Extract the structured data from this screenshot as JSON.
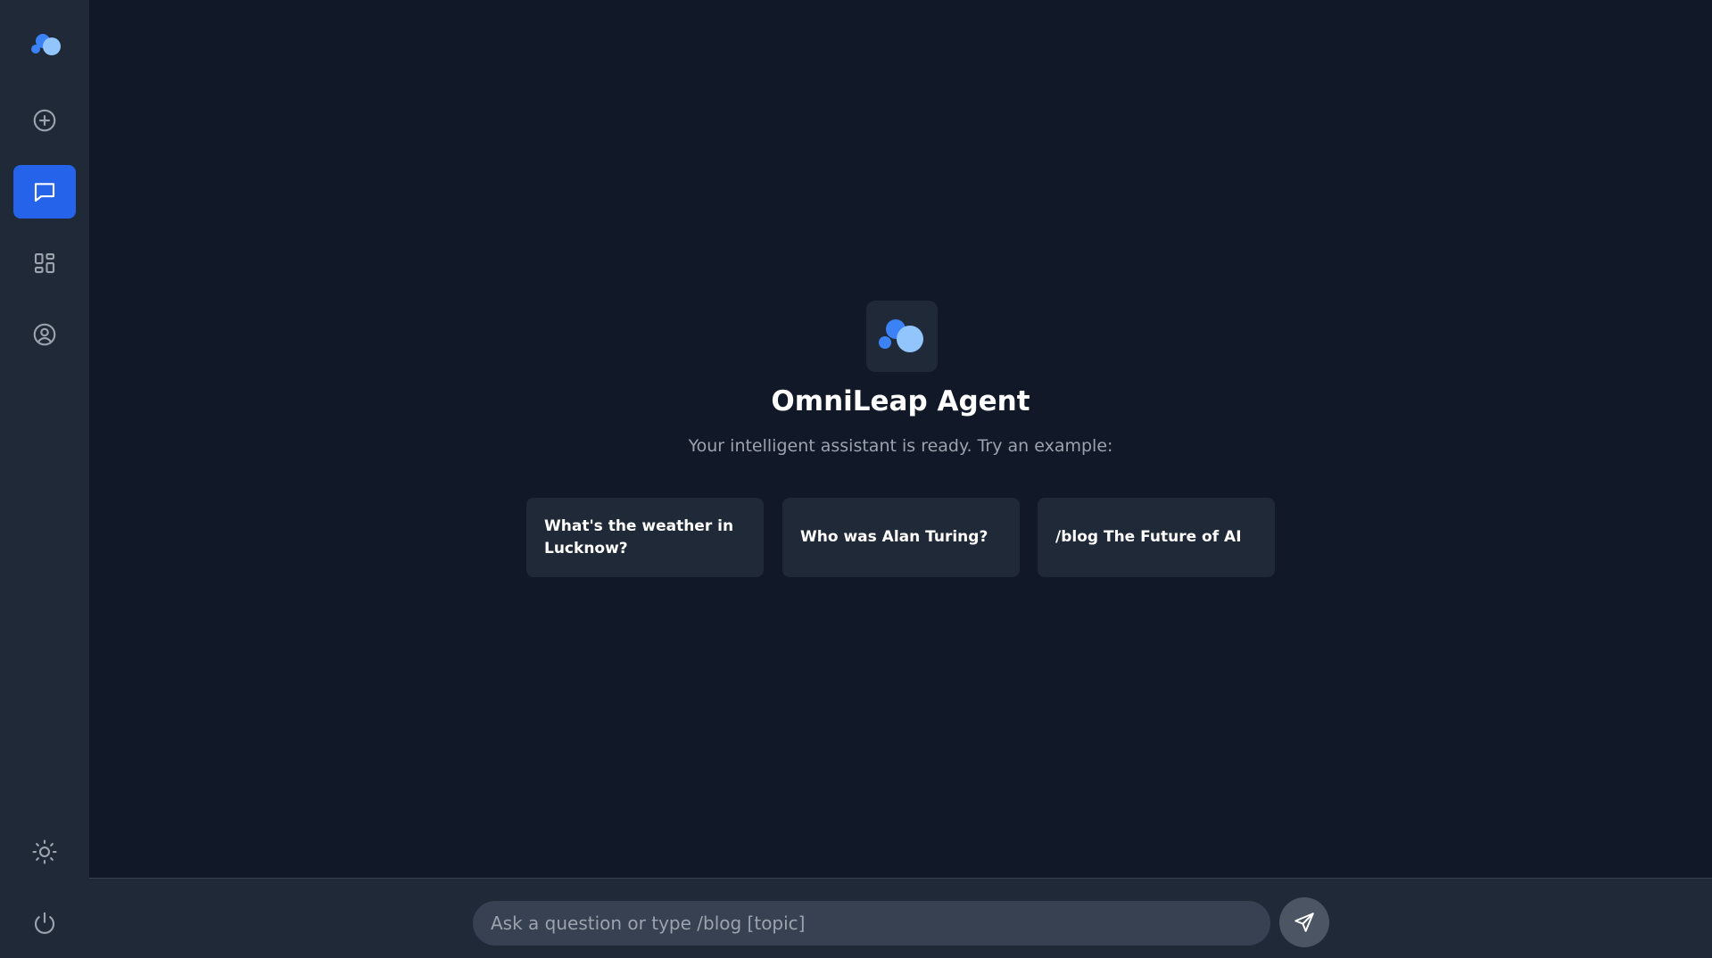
{
  "app": {
    "title": "OmniLeap Agent",
    "subtitle": "Your intelligent assistant is ready. Try an example:"
  },
  "colors": {
    "background": "#111827",
    "sidebar": "#1f2937",
    "accent": "#2563eb",
    "logo_dot_dark": "#3b82f6",
    "logo_dot_light": "#93c5fd"
  },
  "sidebar": {
    "items": [
      {
        "name": "new-chat",
        "icon": "plus-circle-icon",
        "active": false
      },
      {
        "name": "chat",
        "icon": "chat-bubble-icon",
        "active": true
      },
      {
        "name": "dashboard",
        "icon": "grid-icon",
        "active": false
      },
      {
        "name": "profile",
        "icon": "user-circle-icon",
        "active": false
      }
    ],
    "bottom_items": [
      {
        "name": "theme",
        "icon": "sun-icon"
      },
      {
        "name": "logout",
        "icon": "power-icon"
      }
    ]
  },
  "examples": [
    {
      "label": "What's the weather in Lucknow?"
    },
    {
      "label": "Who was Alan Turing?"
    },
    {
      "label": "/blog The Future of AI"
    }
  ],
  "input": {
    "placeholder": "Ask a question or type /blog [topic]",
    "value": ""
  },
  "send": {
    "icon": "send-icon"
  }
}
